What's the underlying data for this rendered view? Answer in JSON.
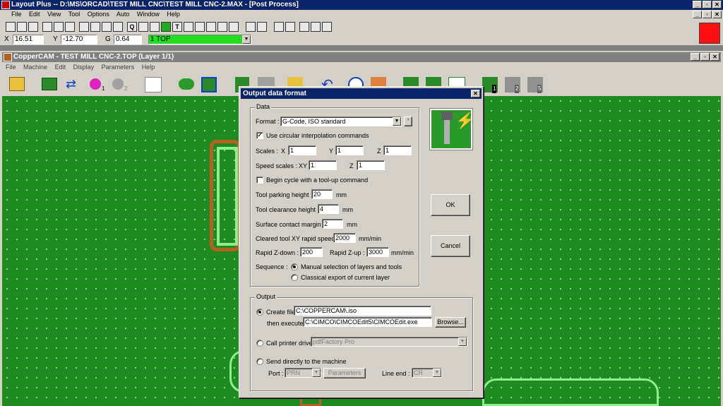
{
  "layout_window": {
    "title": "Layout Plus -- D:\\MS\\ORCAD\\TEST MILL CNC\\TEST MILL CNC-2.MAX - [Post Process]",
    "menu": [
      "File",
      "Edit",
      "View",
      "Tool",
      "Options",
      "Auto",
      "Window",
      "Help"
    ],
    "coords": {
      "x_label": "X",
      "x_value": "16.51",
      "y_label": "Y",
      "y_value": "-12.70",
      "g_label": "G",
      "g_value": "0.64",
      "layer": "1 TOP"
    },
    "toolbar_glyphs": [
      "Q",
      "T"
    ]
  },
  "coppercam": {
    "title": "CopperCAM - TEST MILL CNC-2.TOP (Layer 1/1)",
    "menu": [
      "File",
      "Machine",
      "Edit",
      "Display",
      "Parameters",
      "Help"
    ],
    "toolbar_badges": [
      "1",
      "2",
      "1",
      "2",
      "5"
    ]
  },
  "dialog": {
    "title": "Output data format",
    "data_group": "Data",
    "format_label": "Format :",
    "format_value": "G-Code, ISO standard",
    "circular_label": "Use circular interpolation commands",
    "circular_checked": true,
    "scales_label": "Scales :",
    "scale_x_label": "X",
    "scale_x": "1",
    "scale_y_label": "Y",
    "scale_y": "1",
    "scale_z_label": "Z",
    "scale_z": "1",
    "speed_scales_label": "Speed scales :",
    "speed_xy_label": "XY",
    "speed_xy": "1",
    "speed_z_label": "Z",
    "speed_z": "1",
    "begin_cycle_label": "Begin cycle with a tool-up command",
    "begin_cycle_checked": false,
    "parking_label": "Tool parking height :",
    "parking_value": "20",
    "parking_unit": "mm",
    "clearance_label": "Tool clearance height :",
    "clearance_value": "4",
    "clearance_unit": "mm",
    "surface_label": "Surface contact margin :",
    "surface_value": "2",
    "surface_unit": "mm",
    "cleared_label": "Cleared tool XY rapid speed :",
    "cleared_value": "2000",
    "cleared_unit": "mm/min",
    "rapid_down_label": "Rapid Z-down :",
    "rapid_down_value": "200",
    "rapid_up_label": "Rapid Z-up :",
    "rapid_up_value": "3000",
    "rapid_unit": "mm/min",
    "sequence_label": "Sequence :",
    "seq_manual": "Manual selection of layers and tools",
    "seq_classical": "Classical export of current layer",
    "ok_label": "OK",
    "cancel_label": "Cancel",
    "output_group": "Output",
    "create_file_label": "Create file",
    "create_file_value": "C:\\COPPERCAM\\.iso",
    "then_execute_label": "then execute",
    "then_execute_value": "C:\\CIMCO\\CIMCOEdit5\\CIMCOEdit.exe",
    "browse_label": "Browse...",
    "printer_label": "Call printer driver",
    "printer_value": "pdfFactory Pro",
    "send_label": "Send directly to the machine",
    "port_label": "Port :",
    "port_value": "PRN",
    "parameters_label": "Parameters",
    "line_end_label": "Line end :",
    "line_end_value": "CR"
  },
  "colors": {
    "pcb_green": "#1f8a1f",
    "copper": "#b4601e",
    "pad_light": "#90ee90",
    "title_blue": "#0a246a"
  }
}
